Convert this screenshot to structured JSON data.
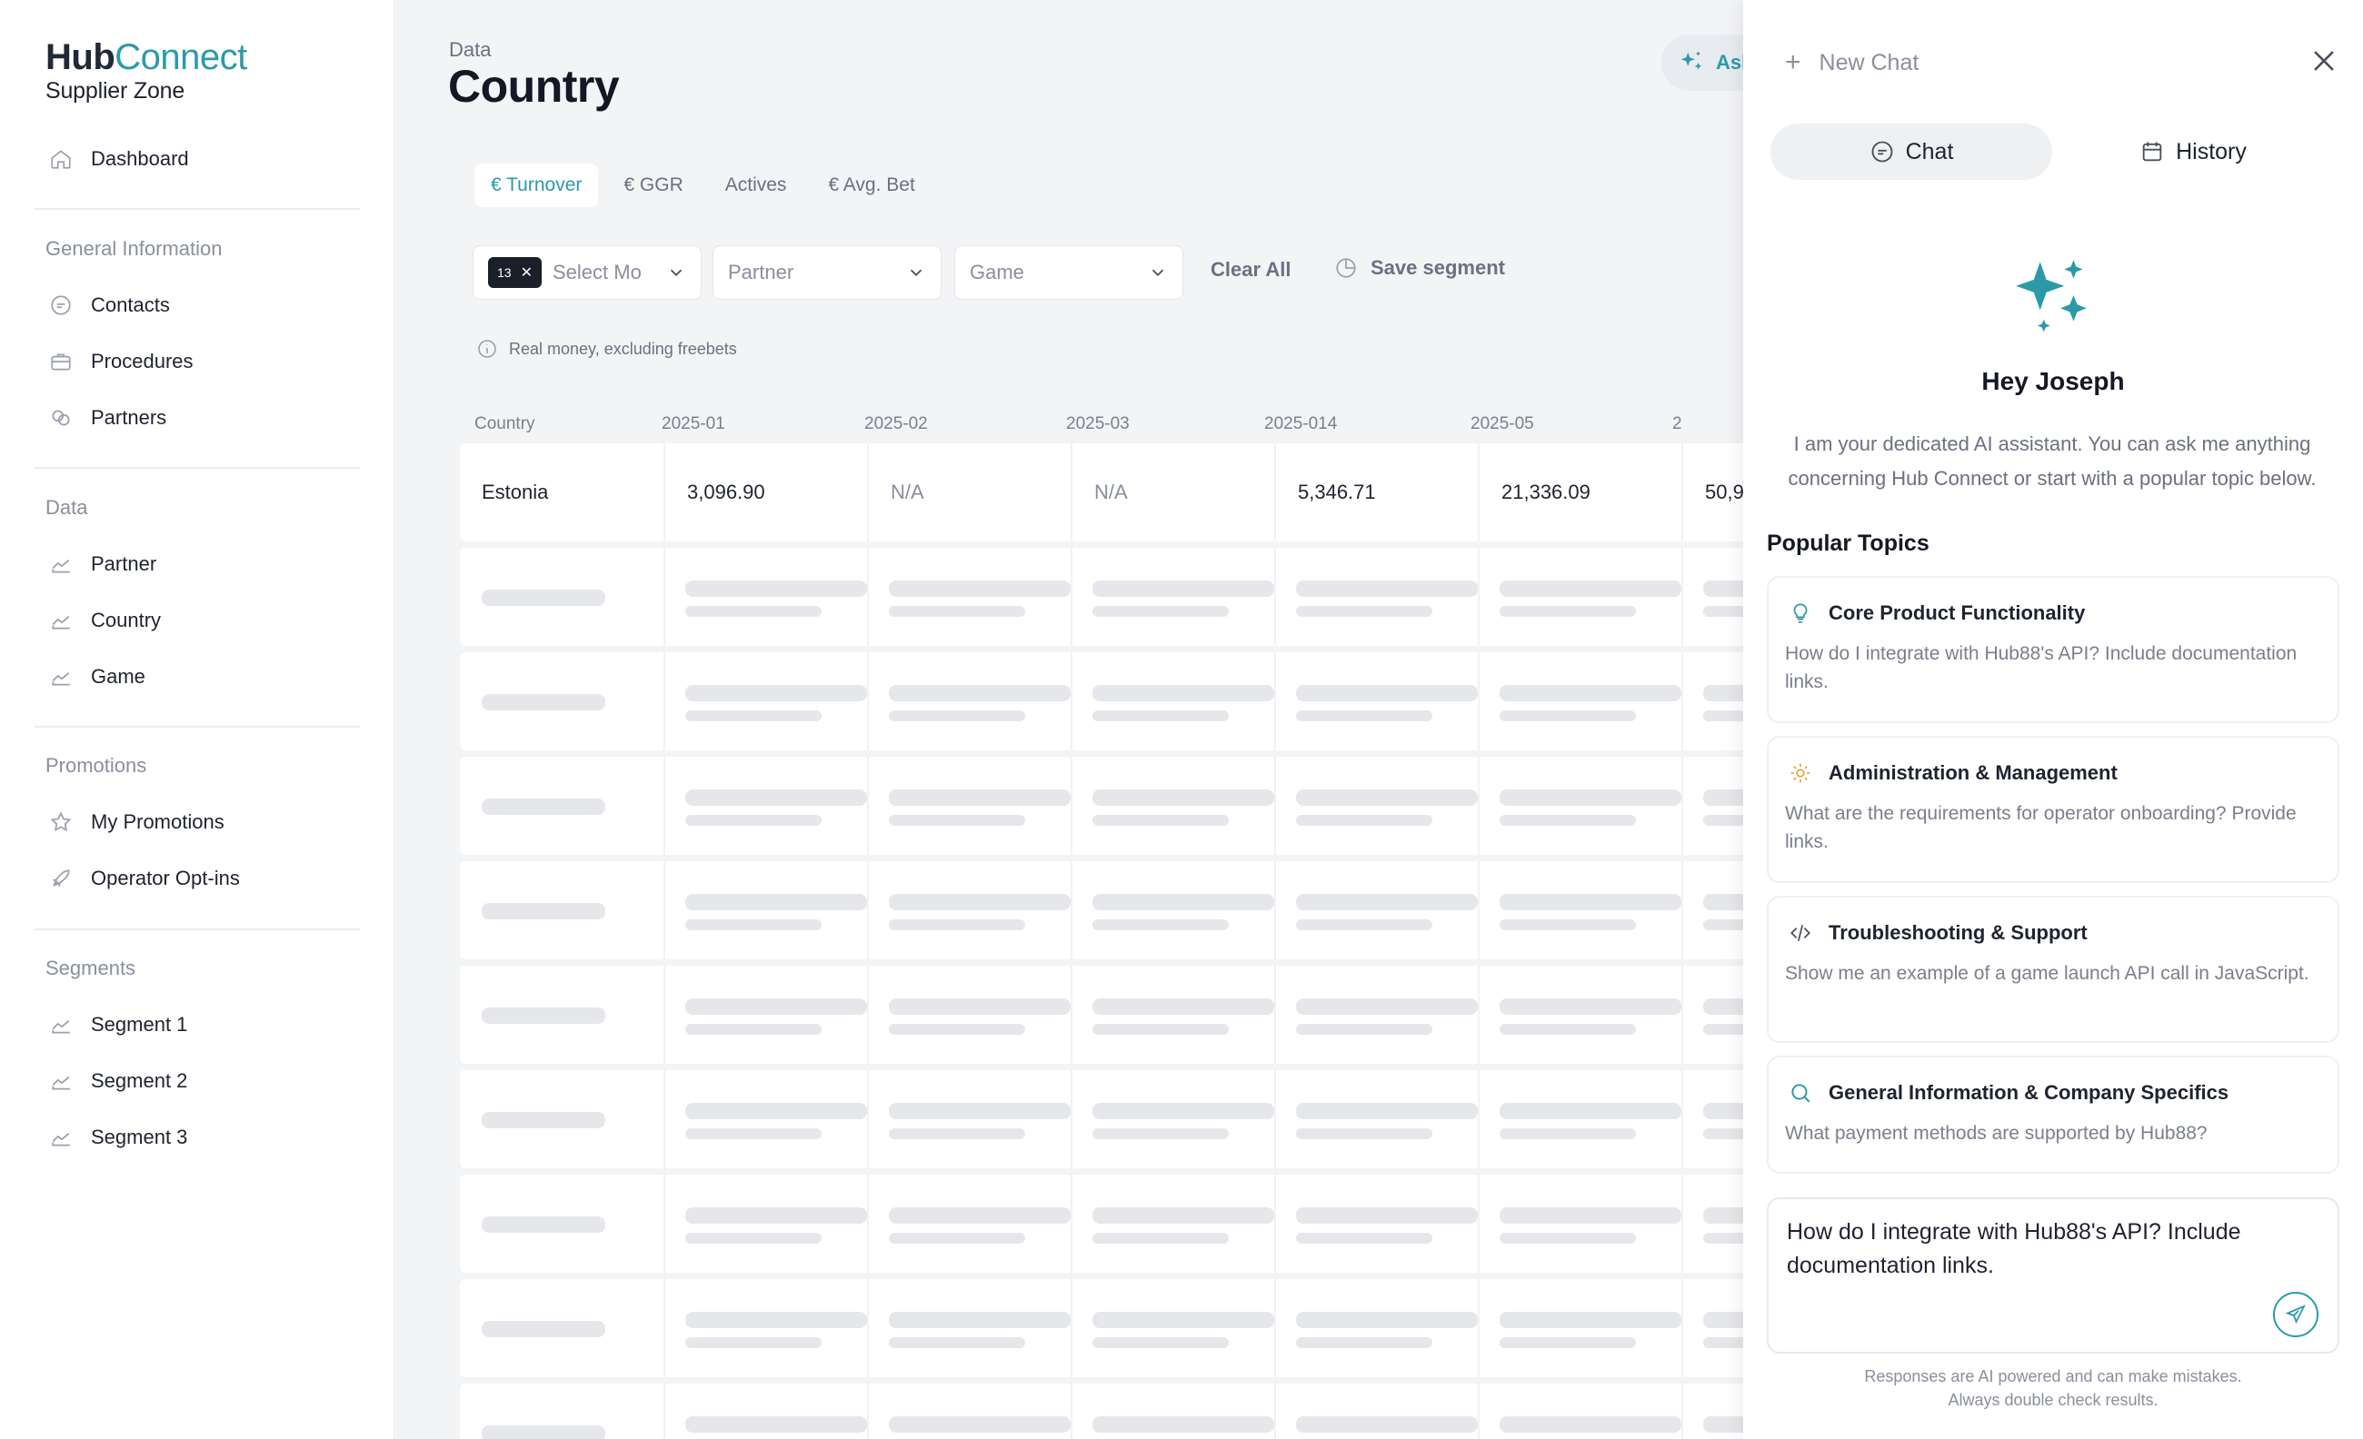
{
  "brand": {
    "name_part1": "Hub",
    "name_part2": "Connect",
    "subtitle": "Supplier Zone"
  },
  "sidebar": {
    "dashboard": "Dashboard",
    "general_title": "General Information",
    "general_items": [
      "Contacts",
      "Procedures",
      "Partners"
    ],
    "data_title": "Data",
    "data_items": [
      "Partner",
      "Country",
      "Game"
    ],
    "promotions_title": "Promotions",
    "promotions_items": [
      "My Promotions",
      "Operator Opt-ins"
    ],
    "segments_title": "Segments",
    "segments_items": [
      "Segment 1",
      "Segment 2",
      "Segment 3"
    ]
  },
  "header": {
    "breadcrumb": "Data",
    "title": "Country",
    "ask_label": "Ask"
  },
  "tabs": [
    "€ Turnover",
    "€ GGR",
    "Actives",
    "€ Avg. Bet"
  ],
  "filters": {
    "month_count": "13",
    "month_placeholder": "Select Mo",
    "partner_placeholder": "Partner",
    "game_placeholder": "Game",
    "clear_all": "Clear All",
    "save_segment": "Save segment"
  },
  "note": "Real money, excluding freebets",
  "table": {
    "columns": [
      "Country",
      "2025-01",
      "2025-02",
      "2025-03",
      "2025-014",
      "2025-05",
      "2"
    ],
    "rows": [
      [
        "Estonia",
        "3,096.90",
        "N/A",
        "N/A",
        "5,346.71",
        "21,336.09",
        "50,9"
      ]
    ]
  },
  "chat": {
    "new_chat": "New Chat",
    "tab_chat": "Chat",
    "tab_history": "History",
    "greeting": "Hey Joseph",
    "intro": "I am your dedicated AI assistant. You can ask me anything concerning Hub Connect or start with a popular topic below.",
    "popular_title": "Popular Topics",
    "topics": [
      {
        "title": "Core Product Functionality",
        "desc": "How do I integrate with Hub88's API? Include documentation links.",
        "icon": "lightbulb-icon"
      },
      {
        "title": "Administration & Management",
        "desc": "What are the requirements for operator onboarding? Provide links.",
        "icon": "gear-icon"
      },
      {
        "title": "Troubleshooting & Support",
        "desc": "Show me an example of a game launch API call in JavaScript.",
        "icon": "code-icon"
      },
      {
        "title": "General Information & Company Specifics",
        "desc": "What payment methods are supported by Hub88?",
        "icon": "search-icon"
      }
    ],
    "composer_text": "How do I integrate with Hub88's API? Include documentation links.",
    "disclaimer_line1": "Responses are AI powered and can make mistakes.",
    "disclaimer_line2": "Always double check results."
  },
  "colors": {
    "accent": "#2b9aa8",
    "accent_gold": "#e0a838",
    "skeleton": "#e6e7ea"
  }
}
